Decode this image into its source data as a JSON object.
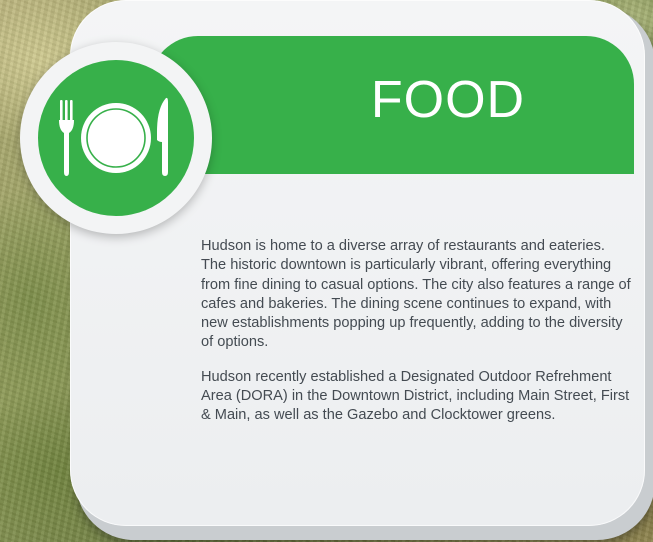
{
  "card": {
    "title": "FOOD",
    "icon": "plate-fork-knife-icon",
    "paragraphs": [
      "Hudson is home to a diverse array of restaurants and eateries. The historic downtown is particularly vibrant, offering everything from fine dining to casual options. The city also features a range of cafes and bakeries. The dining scene continues to expand, with new establishments popping up frequently, adding to the diversity of options.",
      "Hudson recently established a Designated Outdoor Refrehment Area (DORA) in the Downtown District, including Main Street, First & Main, as well as the Gazebo and Clocktower greens."
    ]
  },
  "colors": {
    "accent": "#37b04a",
    "card_background": "#f1f2f3",
    "text": "#444b52"
  }
}
